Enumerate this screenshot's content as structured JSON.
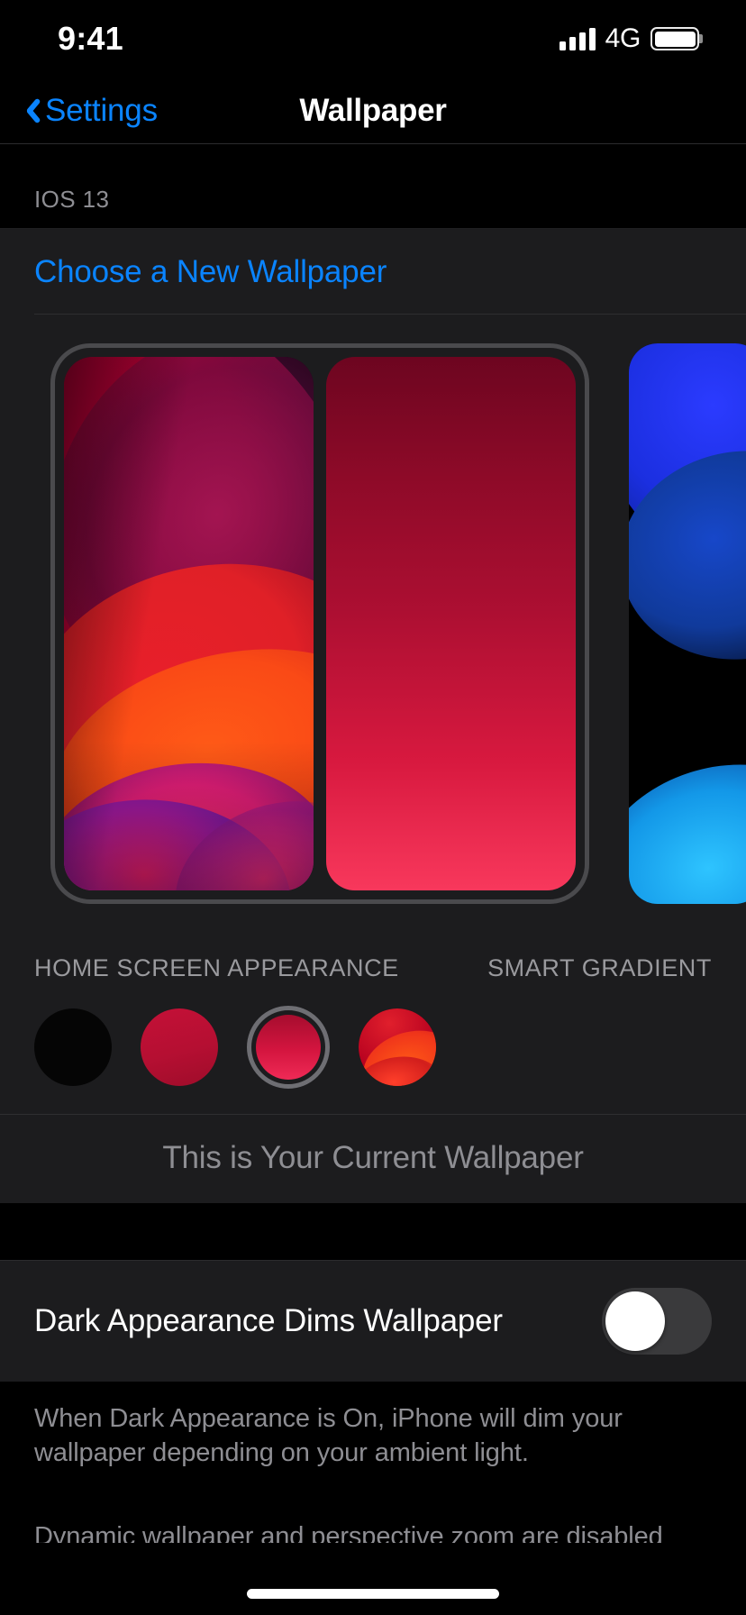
{
  "status_bar": {
    "time": "9:41",
    "network": "4G",
    "signal_bars": 4,
    "battery_full": true
  },
  "nav": {
    "back_label": "Settings",
    "title": "Wallpaper"
  },
  "sections": {
    "os_header": "IOS 13",
    "choose_new_wallpaper": "Choose a New Wallpaper",
    "current_wallpaper": "This is Your Current Wallpaper"
  },
  "preview": {
    "lock_screen_label": "HOME SCREEN APPEARANCE",
    "home_screen_label": "SMART GRADIENT"
  },
  "swatches": [
    {
      "name": "black",
      "color": "#050505",
      "selected": false
    },
    {
      "name": "solid-crimson",
      "color": "#b50f32",
      "selected": false
    },
    {
      "name": "smart-gradient",
      "color": "#d4153f",
      "selected": true
    },
    {
      "name": "original-image",
      "color": "#f0361a",
      "selected": false
    }
  ],
  "dark_appearance": {
    "label": "Dark Appearance Dims Wallpaper",
    "enabled": false
  },
  "footer": {
    "line1": "When Dark Appearance is On, iPhone will dim your wallpaper depending on your ambient light.",
    "line2": "Dynamic wallpaper and perspective zoom are disabled when Low"
  },
  "colors": {
    "accent_blue": "#0a84ff",
    "group_background": "#1c1c1e",
    "page_background": "#000000",
    "secondary_text": "#8e8e93"
  }
}
